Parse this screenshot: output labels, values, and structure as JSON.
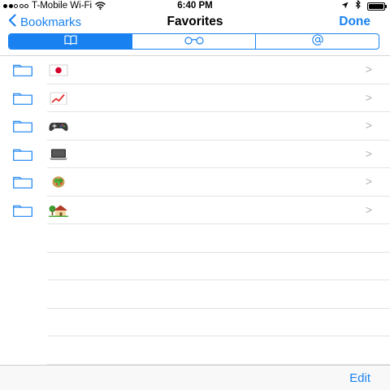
{
  "status_bar": {
    "signal_dots_filled": 2,
    "signal_dots_total": 5,
    "carrier": "T-Mobile Wi-Fi",
    "time": "6:40 PM",
    "icons": [
      "wifi-icon",
      "location-arrow-icon",
      "bluetooth-icon",
      "battery-icon"
    ],
    "battery_level": 1.0
  },
  "nav": {
    "back_label": "Bookmarks",
    "title": "Favorites",
    "done_label": "Done"
  },
  "segments": [
    {
      "icon": "book-icon",
      "selected": true
    },
    {
      "icon": "reading-glasses-icon",
      "selected": false
    },
    {
      "icon": "at-sign-icon",
      "selected": false
    }
  ],
  "bookmarks": [
    {
      "icon": "folder-icon",
      "emoji": "japan-flag-icon",
      "chevron": ">"
    },
    {
      "icon": "folder-icon",
      "emoji": "chart-increasing-icon",
      "chevron": ">"
    },
    {
      "icon": "folder-icon",
      "emoji": "game-controller-icon",
      "chevron": ">"
    },
    {
      "icon": "folder-icon",
      "emoji": "laptop-icon",
      "chevron": ">"
    },
    {
      "icon": "folder-icon",
      "emoji": "green-salad-icon",
      "chevron": ">"
    },
    {
      "icon": "folder-icon",
      "emoji": "house-with-garden-icon",
      "chevron": ">"
    }
  ],
  "toolbar": {
    "edit_label": "Edit"
  },
  "colors": {
    "accent": "#1a82f0",
    "separator": "#e4e4e4",
    "chevron": "#b0b0b5",
    "toolbar_bg": "#f8f8f8"
  }
}
